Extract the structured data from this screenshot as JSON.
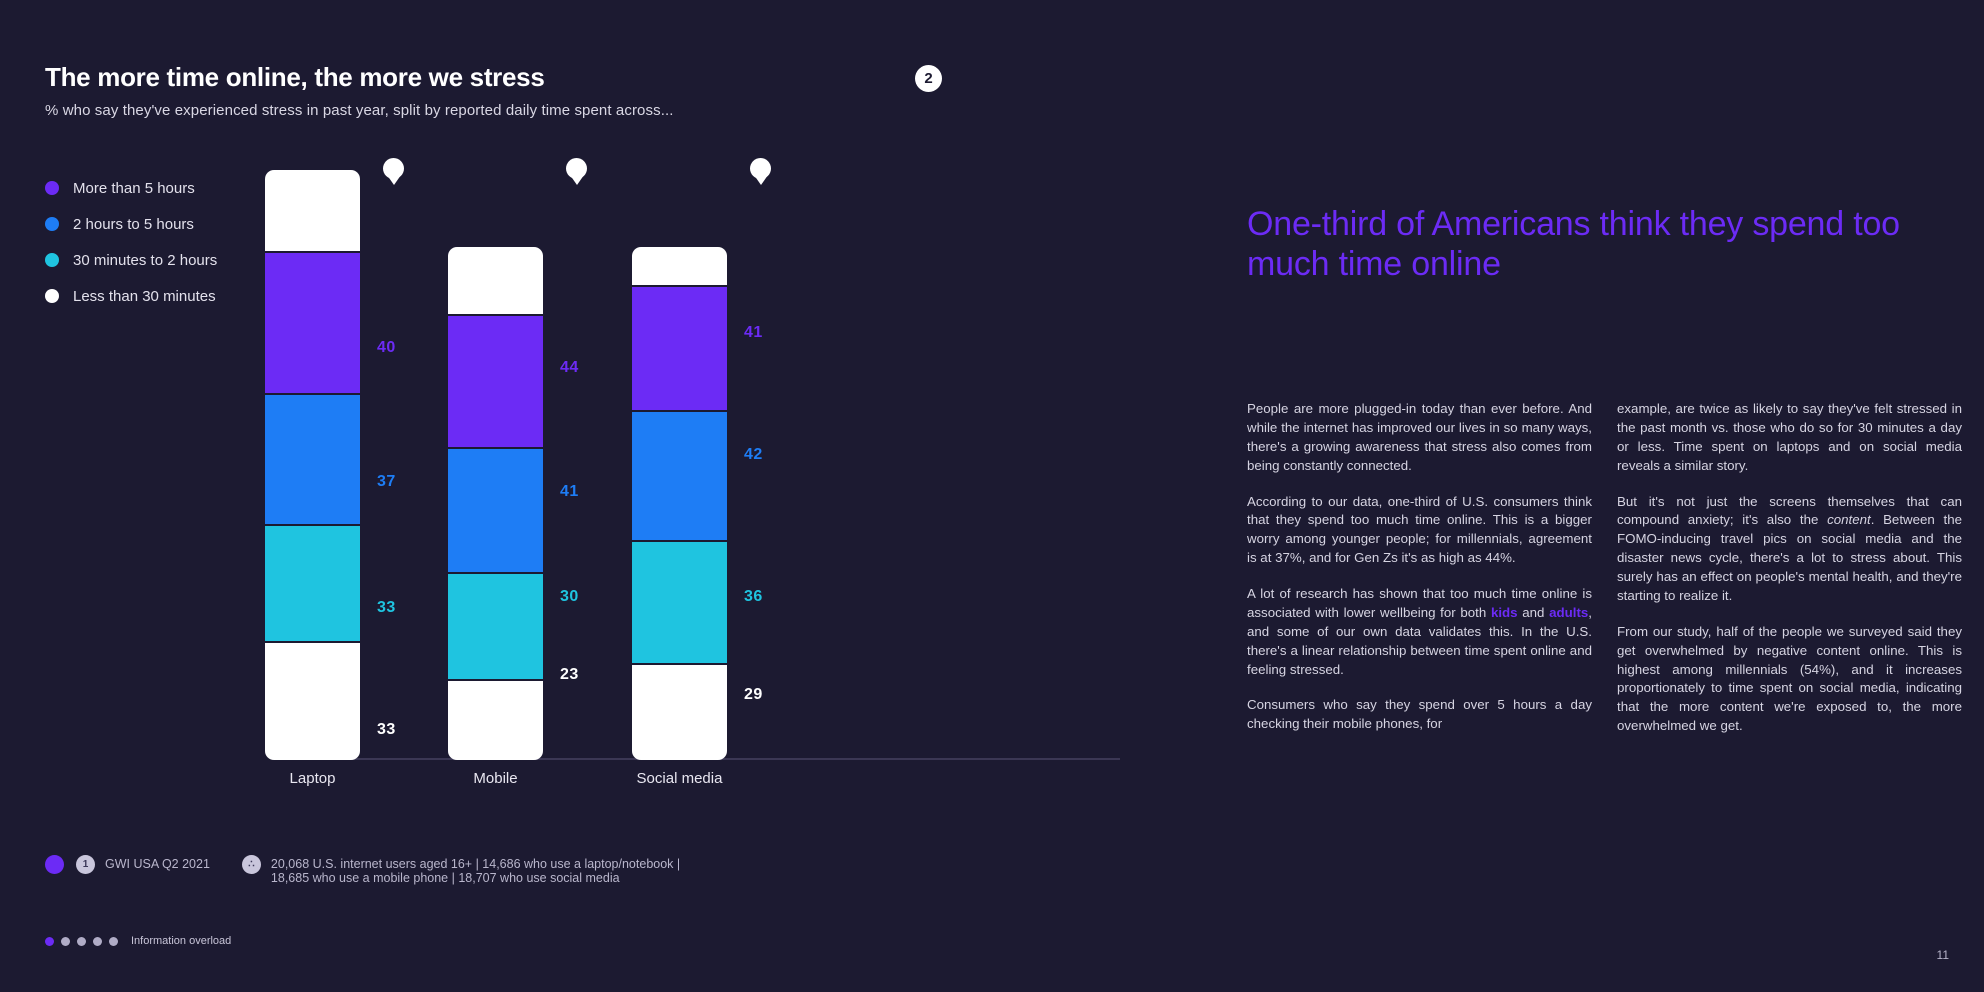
{
  "slide": {
    "title": "The more time online, the more we stress",
    "subtitle": "% who say they've experienced stress in past year, split by reported daily time spent across...",
    "step_badge": "2",
    "page_number": "11",
    "section_label": "Information overload"
  },
  "colors": {
    "background": "#1c1a31",
    "purple": "#6c2bf5",
    "blue": "#1e7df5",
    "cyan": "#1fc4e0",
    "white": "#ffffff"
  },
  "legend": {
    "items": [
      {
        "label": "More than 5 hours",
        "color": "#6c2bf5"
      },
      {
        "label": "2 hours to 5 hours",
        "color": "#1e7df5"
      },
      {
        "label": "30 minutes to 2 hours",
        "color": "#1fc4e0"
      },
      {
        "label": "Less than 30 minutes",
        "color": "#ffffff"
      }
    ]
  },
  "chart_data": {
    "type": "bar",
    "title": "The more time online, the more we stress",
    "subtitle": "% who say they've experienced stress in past year, split by reported daily time spent across...",
    "xlabel": "",
    "ylabel": "",
    "ylim": [
      0,
      160
    ],
    "grid": false,
    "legend_position": "top-left",
    "stacked": false,
    "categories": [
      "Laptop",
      "Mobile",
      "Social media"
    ],
    "series": [
      {
        "name": "More than 5 hours",
        "color": "#6c2bf5",
        "values": [
          40,
          44,
          41
        ]
      },
      {
        "name": "2 hours to 5 hours",
        "color": "#1e7df5",
        "values": [
          37,
          41,
          42
        ]
      },
      {
        "name": "30 minutes to 2 hours",
        "color": "#1fc4e0",
        "values": [
          33,
          30,
          36
        ]
      },
      {
        "name": "Less than 30 minutes",
        "color": "#ffffff",
        "values": [
          33,
          23,
          29
        ]
      }
    ]
  },
  "source": {
    "badge_purple": "",
    "badge_one": "1",
    "survey": "GWI USA Q2 2021",
    "base_line1": "20,068 U.S. internet users aged 16+  |  14,686 who use a laptop/notebook  |",
    "base_line2": "18,685 who use a mobile phone  |  18,707 who use social media"
  },
  "article": {
    "headline": "One-third of Americans think they spend too much time online",
    "left_col": {
      "p1": "People are more plugged-in today than ever before. And while the internet has improved our lives in so many ways, there's a growing awareness that stress also comes from being constantly connected.",
      "p2": "According to our data, one-third of U.S. consumers think that they spend too much time online. This is a bigger worry among younger people; for millennials, agreement is at 37%, and for Gen Zs it's as high as 44%.",
      "p3_a": "A lot of research has shown that too much time online is associated with lower wellbeing for both ",
      "p3_kids": "kids",
      "p3_b": " and ",
      "p3_adults": "adults",
      "p3_c": ", and some of our own data validates this. In the U.S. there's a linear relationship between time spent online and feeling stressed.",
      "p4": "Consumers who say they spend over 5 hours a day checking their mobile phones, for"
    },
    "right_col": {
      "p1": "example, are twice as likely to say they've felt stressed in the past month vs. those who do so for 30 minutes a day or less. Time spent on laptops and on social media reveals a similar story.",
      "p2_a": "But it's not just the screens themselves that can compound anxiety; it's also the ",
      "p2_italic": "content",
      "p2_b": ". Between the FOMO-inducing travel pics on social media and the disaster news cycle, there's a lot to stress about. This surely has an effect on people's mental health, and they're starting to realize it.",
      "p3": "From our study, half of the people we surveyed said they get overwhelmed by negative content online. This is highest among millennials (54%), and it increases proportionately to time spent on social media, indicating that the more content we're exposed to, the more overwhelmed we get."
    }
  }
}
